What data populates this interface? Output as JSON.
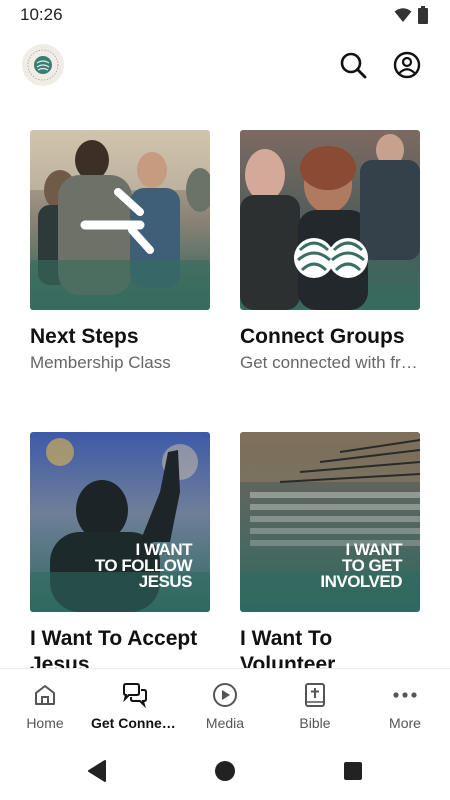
{
  "status": {
    "time": "10:26"
  },
  "header": {
    "logo_icon": "church-logo-icon",
    "search_icon": "search-icon",
    "profile_icon": "account-icon"
  },
  "cards": [
    {
      "title": "Next Steps",
      "subtitle": "Membership Class",
      "image": "next-steps-image"
    },
    {
      "title": "Connect Groups",
      "subtitle": "Get connected with friends",
      "image": "connect-groups-image"
    },
    {
      "title": "I Want To Accept Jesus",
      "subtitle": "",
      "image": "follow-jesus-image",
      "overlay_lines": [
        "I WANT",
        "TO FOLLOW",
        "JESUS"
      ]
    },
    {
      "title": "I Want To Volunteer",
      "subtitle": "",
      "image": "get-involved-image",
      "overlay_lines": [
        "I WANT",
        "TO GET",
        "INVOLVED"
      ]
    }
  ],
  "nav": {
    "items": [
      {
        "label": "Home",
        "icon": "home-icon"
      },
      {
        "label": "Get Connected",
        "icon": "chat-bubbles-icon",
        "active": true
      },
      {
        "label": "Media",
        "icon": "play-circle-icon"
      },
      {
        "label": "Bible",
        "icon": "bible-icon"
      },
      {
        "label": "More",
        "icon": "more-horizontal-icon"
      }
    ]
  },
  "colors": {
    "accent": "#2f7a6a",
    "card_fade": "#3e7a6c",
    "text_primary": "#111111",
    "text_secondary": "#666666"
  }
}
